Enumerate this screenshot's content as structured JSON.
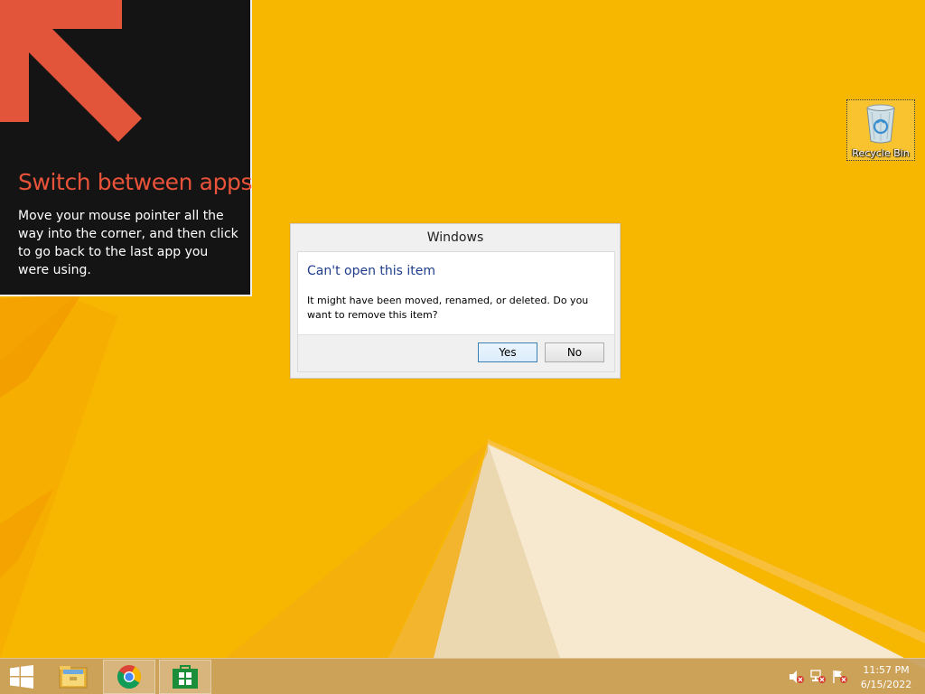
{
  "tip": {
    "title": "Switch between apps",
    "body": "Move your mouse pointer all the way into the corner, and then click to go back to the last app you were using.",
    "arrow_color": "#e2553a",
    "title_color": "#e8533a"
  },
  "desktop": {
    "background_color": "#f7b600",
    "icons": [
      {
        "label": "Recycle Bin",
        "icon": "recycle-bin-icon"
      }
    ]
  },
  "dialog": {
    "title": "Windows",
    "heading": "Can't open this item",
    "message": "It might have been moved, renamed, or deleted. Do you want to remove this item?",
    "buttons": {
      "yes": "Yes",
      "no": "No"
    },
    "default_button": "yes"
  },
  "taskbar": {
    "items": [
      {
        "name": "start",
        "icon": "windows-logo-icon"
      },
      {
        "name": "file-explorer",
        "icon": "folder-icon"
      },
      {
        "name": "chrome",
        "icon": "chrome-icon"
      },
      {
        "name": "store",
        "icon": "store-icon"
      }
    ],
    "tray_icons": [
      "volume-muted-icon",
      "network-error-icon",
      "action-center-flag-icon"
    ],
    "clock": {
      "time": "11:57 PM",
      "date": "6/15/2022"
    }
  }
}
